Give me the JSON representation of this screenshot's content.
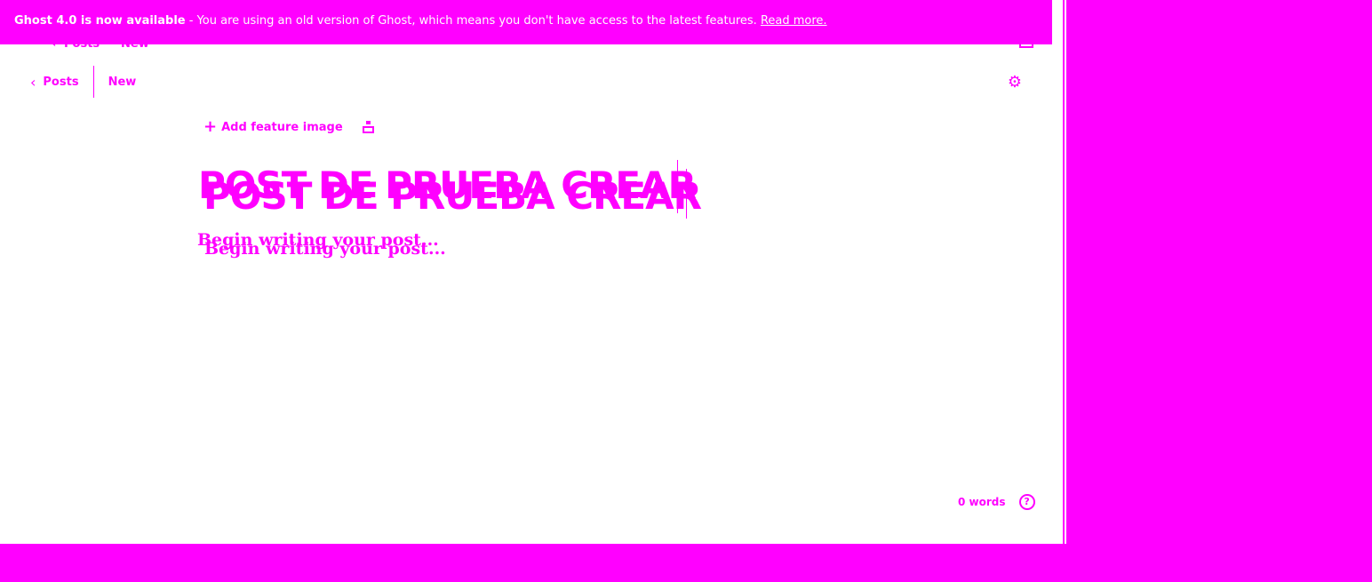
{
  "banner": {
    "strong": "Ghost 4.0 is now available",
    "message": " - You are using an old version of Ghost, which means you don't have access to the latest features. ",
    "link": "Read more."
  },
  "nav": {
    "back_label": "Posts",
    "status_label": "New"
  },
  "editor": {
    "feature_image_label": "Add feature image",
    "title": "POST DE PRUEBA CREAR",
    "body_placeholder": "Begin writing your post..."
  },
  "footer": {
    "word_count": "0 words",
    "help_symbol": "?"
  },
  "icons": {
    "back": "chevron-left-icon",
    "settings": "gear-icon",
    "feature": "plus-icon",
    "unsplash": "unsplash-icon",
    "help": "question-circle-icon"
  },
  "colors": {
    "accent": "#ff00ff",
    "background": "#ffffff"
  }
}
